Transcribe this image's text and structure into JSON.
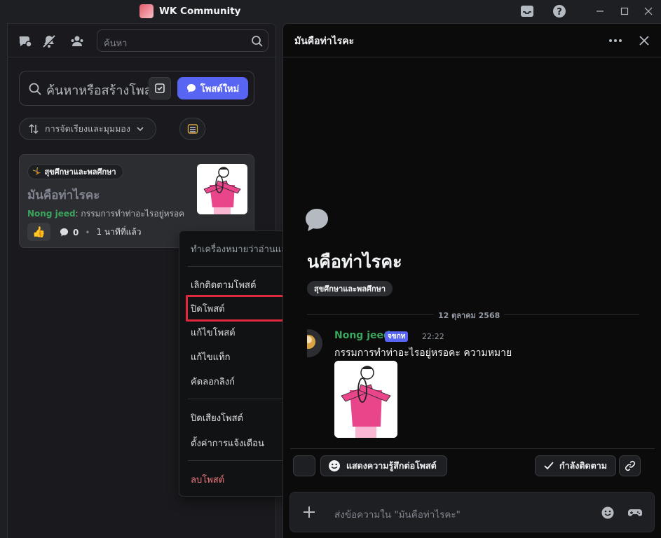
{
  "window": {
    "title": "WK Community",
    "icons": [
      "app-icon",
      "inbox-icon",
      "help-icon",
      "minimize-icon",
      "maximize-icon",
      "close-icon"
    ]
  },
  "left_panel": {
    "toolbar_icons": [
      "threads-icon",
      "mute-bell-icon",
      "members-icon"
    ],
    "search_placeholder": "ค้นหา",
    "create_placeholder": "ค้นหาหรือสร้างโพสต์",
    "new_post_label": "โพสต์ใหม่",
    "sort_label": "การจัดเรียงและมุมมอง",
    "post": {
      "tag": "สุขศึกษาและพลศึกษา",
      "title": "มันคือท่าไรคะ",
      "author": "Nong jeed",
      "preview": ": กรรมการทำท่าอะไรอยู่หรอคะ ความหมาย",
      "reaction_emoji": "👍",
      "reply_count": "0",
      "time": "1 นาทีที่แล้ว"
    }
  },
  "context_menu": {
    "items": [
      {
        "label": "ทำเครื่องหมายว่าอ่านแล้ว",
        "muted": true
      },
      {
        "label": "เลิกติดตามโพสต์"
      },
      {
        "label": "ปิดโพสต์",
        "highlighted": true
      },
      {
        "label": "แก้ไขโพสต์"
      },
      {
        "label": "แก้ไขแท็ก",
        "submenu": true
      },
      {
        "label": "คัดลอกลิงก์"
      },
      {
        "label": "ปิดเสียงโพสต์",
        "submenu": true
      },
      {
        "label": "ตั้งค่าการแจ้งเตือน",
        "submenu": true
      },
      {
        "label": "ลบโพสต์",
        "danger": true
      }
    ],
    "highlight_color": "#e0283c"
  },
  "right_panel": {
    "header_title": "มันคือท่าไรคะ",
    "big_title": "นคือท่าไรคะ",
    "tag": "สุขศึกษาและพลศึกษา",
    "date_divider": "12 ตุลาคม 2568",
    "message": {
      "author": "Nong jeed",
      "badge": "จขกท",
      "time": "22:22",
      "text": "กรรมการทำท่าอะไรอยู่หรอคะ ความหมาย"
    },
    "react_label": "แสดงความรู้สึกต่อโพสต์",
    "follow_label": "กำลังติดตาม",
    "composer_placeholder": "ส่งข้อความใน \"มันคือท่าไรคะ\""
  },
  "colors": {
    "accent": "#5865f2",
    "author_green": "#3ba55c",
    "danger": "#f27980"
  }
}
